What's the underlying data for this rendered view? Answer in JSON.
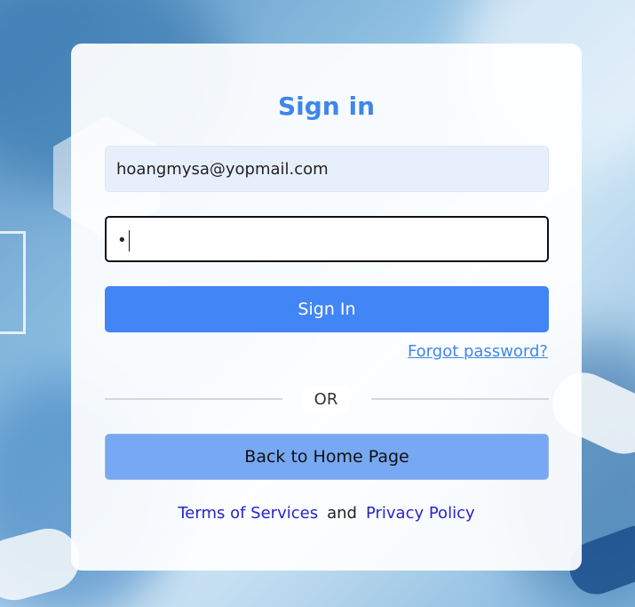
{
  "form": {
    "title": "Sign in",
    "email_value": "hoangmysa@yopmail.com",
    "password_value": "•",
    "signin_label": "Sign In",
    "forgot_label": "Forgot password?",
    "or_label": "OR",
    "home_label": "Back to Home Page"
  },
  "footer": {
    "terms_label": "Terms of Services",
    "and_label": "and",
    "privacy_label": "Privacy Policy"
  },
  "colors": {
    "accent": "#4285f4",
    "title": "#3f86e8",
    "home_button": "#77a8f3",
    "footer_link": "#2525c9"
  }
}
